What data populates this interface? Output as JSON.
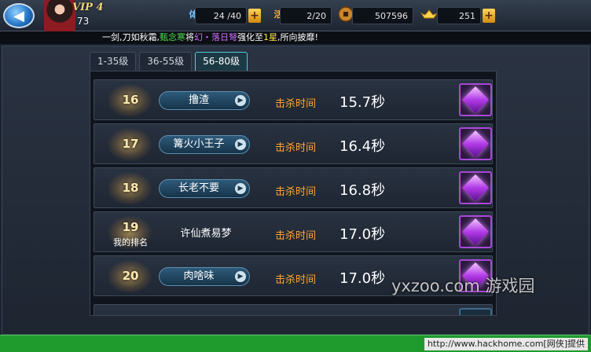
{
  "header": {
    "back_label": "◀",
    "vip": "VIP 4",
    "level": "73",
    "stamina": "24 /40",
    "stamina_icon_text": "体",
    "energy": "2/20",
    "energy_icon_text": "活",
    "coins": "507596",
    "gold": "251",
    "plus_label": "+"
  },
  "marquee": {
    "part1": "一剑,刀如秋霜,",
    "player": "甄念寒",
    "part2": "将",
    "item": "幻・落日弩",
    "part3": "强化至",
    "stars": "1星",
    "part4": ",所向披靡!"
  },
  "tabs": [
    {
      "label": "1-35级",
      "active": false
    },
    {
      "label": "36-55级",
      "active": false
    },
    {
      "label": "56-80级",
      "active": true
    }
  ],
  "rows": [
    {
      "rank": "16",
      "name": "撸渣",
      "kill_label": "击杀时间",
      "time": "15.7秒"
    },
    {
      "rank": "17",
      "name": "篝火小王子",
      "kill_label": "击杀时间",
      "time": "16.4秒"
    },
    {
      "rank": "18",
      "name": "长老不要",
      "kill_label": "击杀时间",
      "time": "16.8秒"
    },
    {
      "rank": "19",
      "rank_sub": "我的排名",
      "name": "许仙煮易梦",
      "kill_label": "击杀时间",
      "time": "17.0秒"
    },
    {
      "rank": "20",
      "name": "肉啥味",
      "kill_label": "击杀时间",
      "time": "17.0秒"
    }
  ],
  "button_arrow": "▶",
  "watermark": "yxzoo.com 游戏园",
  "footer": "http://www.hackhome.com[网侠]提供",
  "colors": {
    "kill_label": "#ffa53a",
    "active_tab_border": "#58c6d8",
    "reward_border": "#a64ad8",
    "footer_bg": "#1f9b2e"
  }
}
